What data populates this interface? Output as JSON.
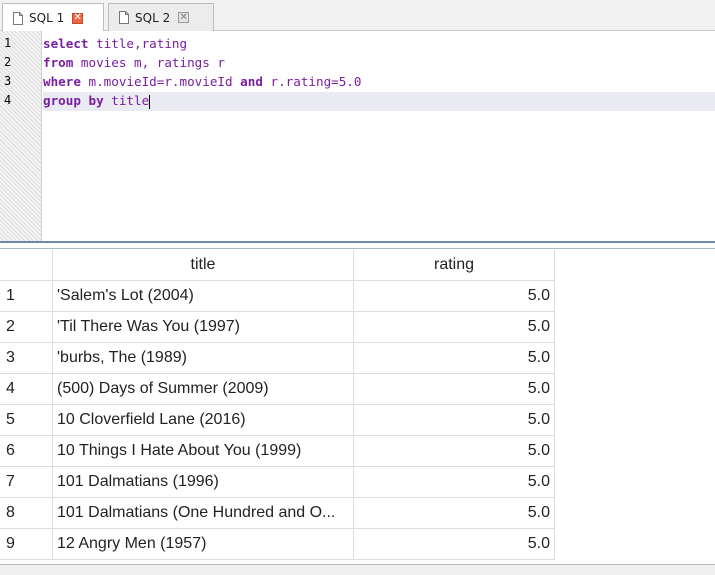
{
  "tabs": [
    {
      "label": "SQL 1",
      "active": true
    },
    {
      "label": "SQL 2",
      "active": false
    }
  ],
  "editor": {
    "line_numbers": [
      "1",
      "2",
      "3",
      "4"
    ],
    "lines": [
      {
        "kw1": "select",
        "rest1": " title,rating"
      },
      {
        "kw1": "from",
        "rest1": " movies m, ratings r"
      },
      {
        "kw1": "where",
        "rest1": " m.movieId=r.movieId ",
        "kw2": "and",
        "rest2": " r.rating=5.0"
      },
      {
        "kw1": "group",
        "mid": " ",
        "kw2": "by",
        "rest2": " title"
      }
    ]
  },
  "results": {
    "columns": [
      "title",
      "rating"
    ],
    "rows": [
      {
        "n": "1",
        "title": "'Salem's Lot (2004)",
        "rating": "5.0"
      },
      {
        "n": "2",
        "title": "'Til There Was You (1997)",
        "rating": "5.0"
      },
      {
        "n": "3",
        "title": "'burbs, The (1989)",
        "rating": "5.0"
      },
      {
        "n": "4",
        "title": "(500) Days of Summer (2009)",
        "rating": "5.0"
      },
      {
        "n": "5",
        "title": "10 Cloverfield Lane (2016)",
        "rating": "5.0"
      },
      {
        "n": "6",
        "title": "10 Things I Hate About You (1999)",
        "rating": "5.0"
      },
      {
        "n": "7",
        "title": "101 Dalmatians (1996)",
        "rating": "5.0"
      },
      {
        "n": "8",
        "title": "101 Dalmatians (One Hundred and O...",
        "rating": "5.0"
      },
      {
        "n": "9",
        "title": "12 Angry Men (1957)",
        "rating": "5.0"
      }
    ]
  },
  "colors": {
    "keyword": "#7a1ea1",
    "close_active": "#e8684a",
    "splitter": "#6f8aa8"
  },
  "icons": {
    "tab_document": "document-icon",
    "tab_close": "close-icon"
  }
}
